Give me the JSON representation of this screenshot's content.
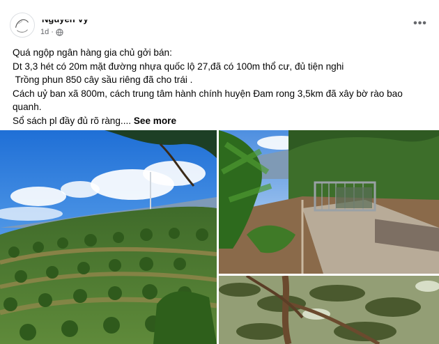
{
  "post": {
    "author_name": "Nguyễn Vy",
    "timestamp": "1d",
    "privacy_icon": "globe-icon",
    "more_icon": "more-horizontal-icon",
    "more_label": "•••",
    "lines": [
      "Quá ngộp ngân hàng gia chủ gởi bán:",
      "Dt 3,3 hét có 20m mặt đường nhựa quốc lộ 27,đã có 100m thổ cư, đủ tiện nghi",
      " Trồng phun 850 cây sầu riêng đã cho trái .",
      "Cách uỷ ban xã 800m, cách trung tâm hành chính huyện Đam rong 3,5km đã xây bờ rào bao",
      "quanh."
    ],
    "last_line": "Sổ sách pl đầy đủ rõ ràng....",
    "see_more_label": "See more"
  },
  "photos": [
    {
      "icon": "durian-orchard-hillside-photo"
    },
    {
      "icon": "farm-gate-driveway-photo"
    },
    {
      "icon": "durian-tree-canopy-photo"
    }
  ]
}
